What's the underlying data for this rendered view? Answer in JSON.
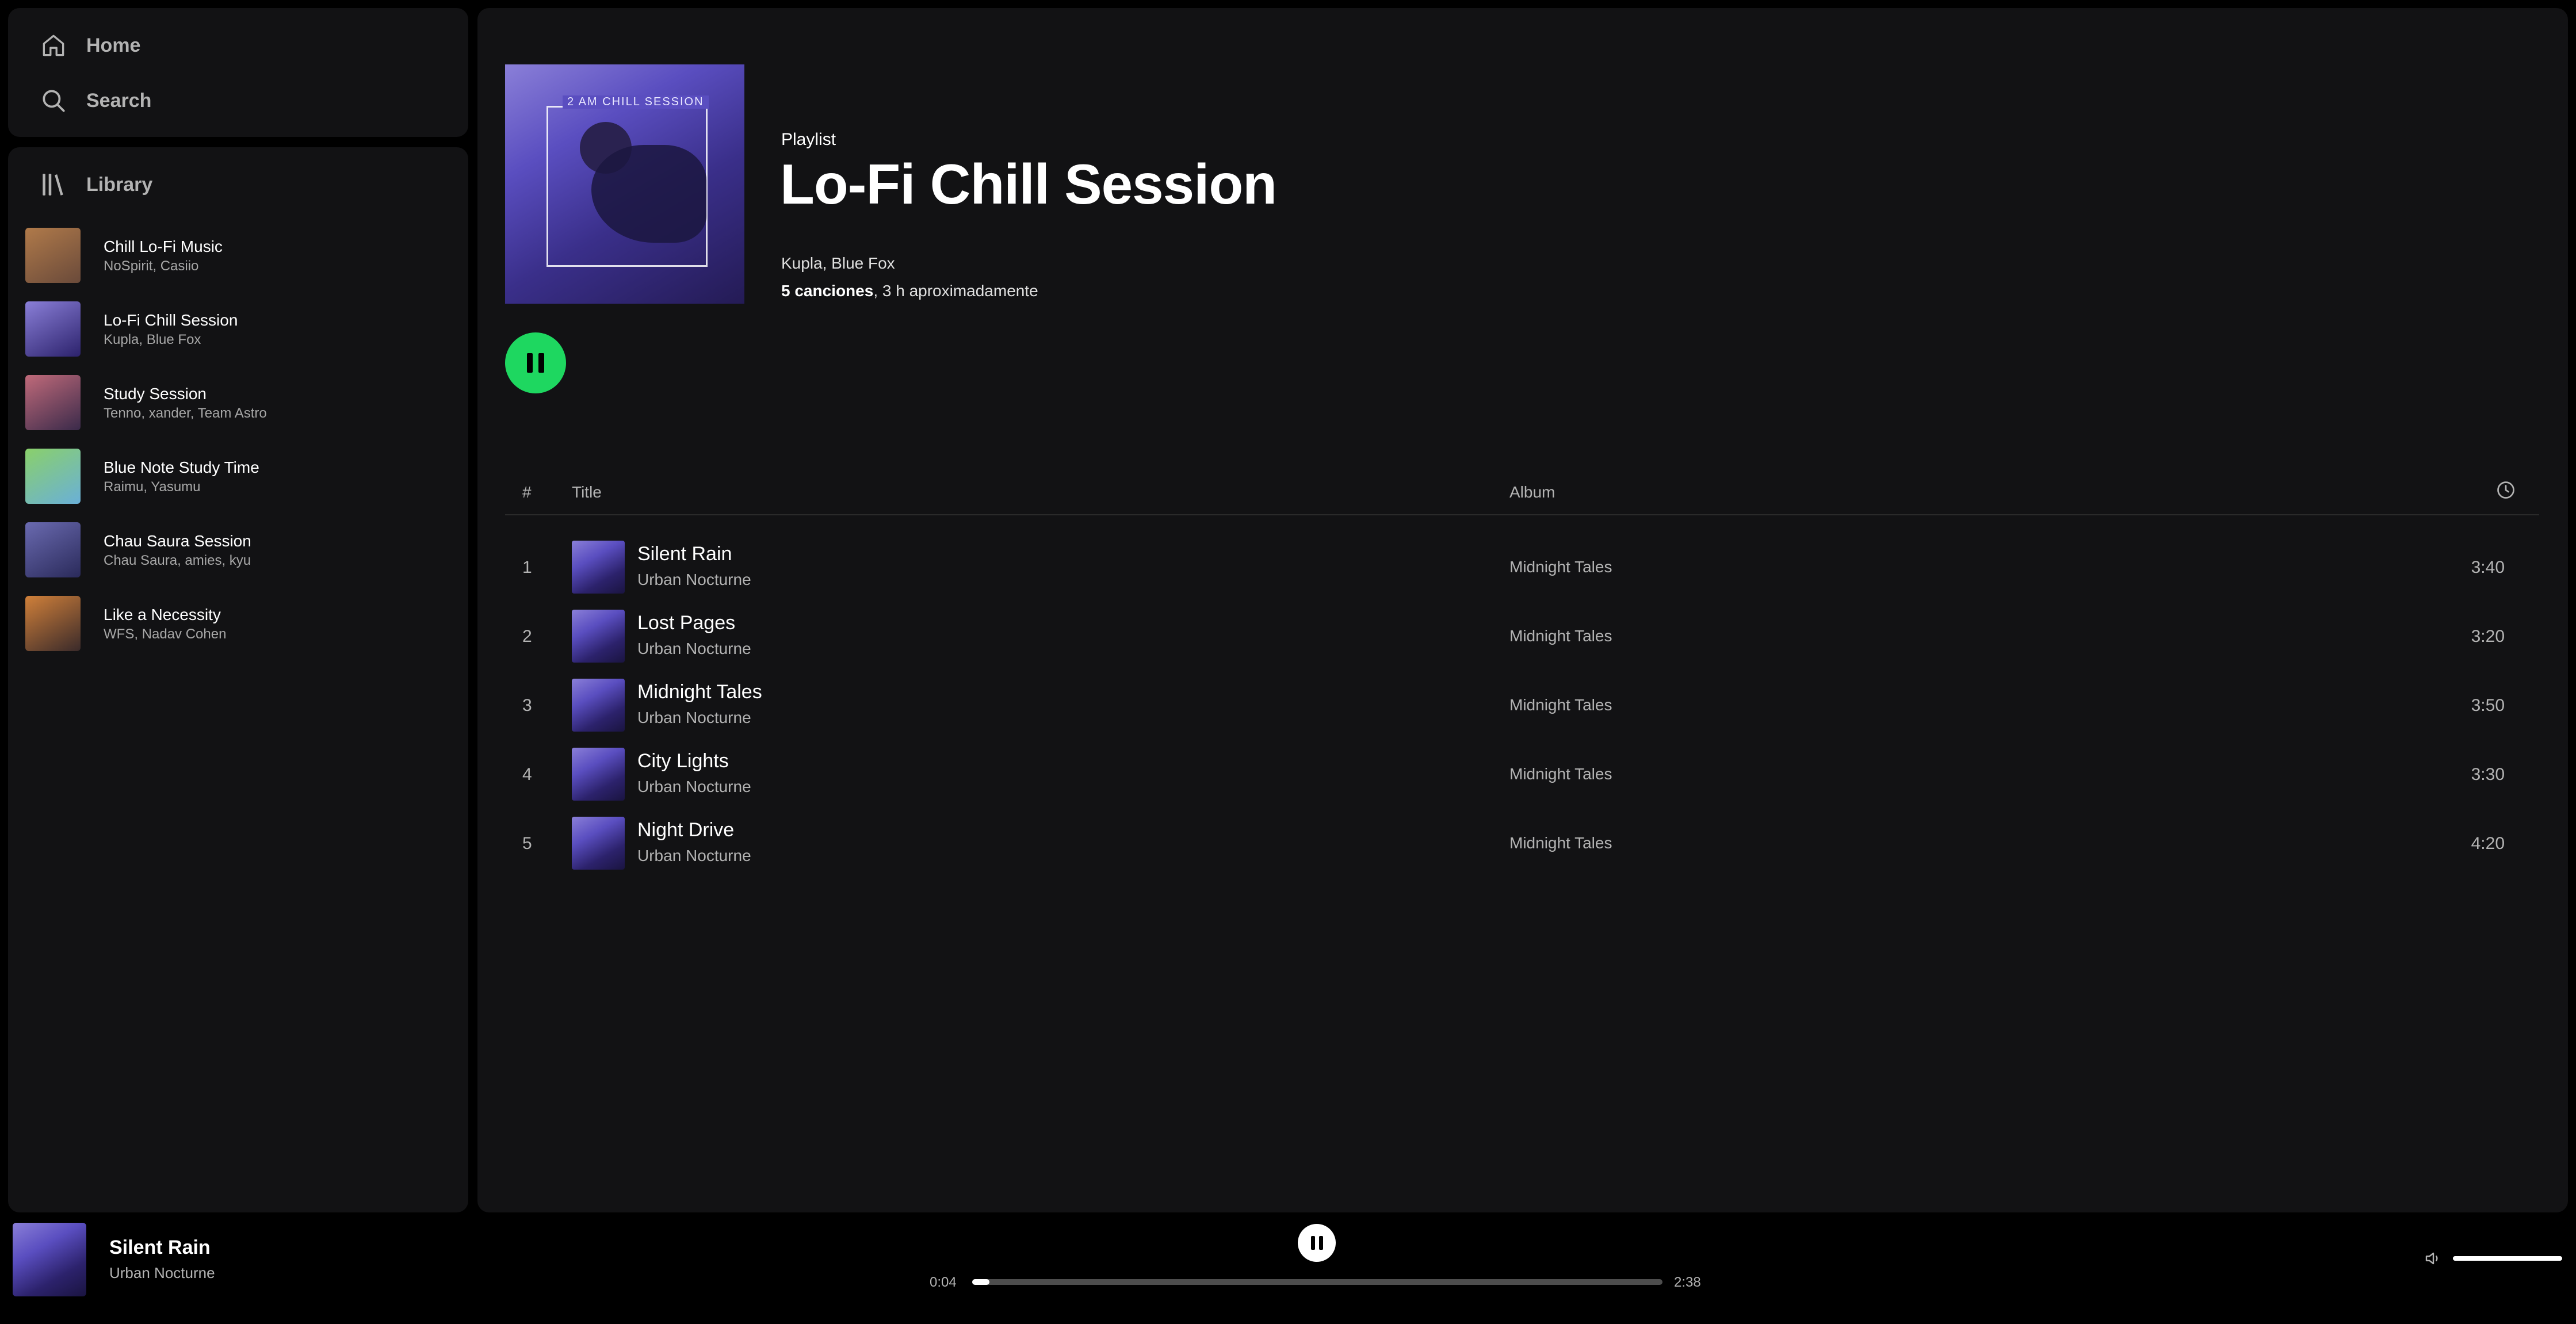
{
  "nav": {
    "home_label": "Home",
    "search_label": "Search"
  },
  "library": {
    "title": "Library",
    "items": [
      {
        "name": "Chill Lo-Fi Music",
        "subtitle": "NoSpirit, Casiio",
        "colors": [
          "#6a4a3a",
          "#b07a4a"
        ]
      },
      {
        "name": "Lo-Fi Chill Session",
        "subtitle": "Kupla, Blue Fox",
        "colors": [
          "#2c226c",
          "#8a7fd8"
        ]
      },
      {
        "name": "Study Session",
        "subtitle": "Tenno, xander, Team Astro",
        "colors": [
          "#3a2a4a",
          "#c06a7a"
        ]
      },
      {
        "name": "Blue Note Study Time",
        "subtitle": "Raimu, Yasumu",
        "colors": [
          "#6ab0d8",
          "#8ad06a"
        ]
      },
      {
        "name": "Chau Saura Session",
        "subtitle": "Chau Saura, amies, kyu",
        "colors": [
          "#2a2a5a",
          "#6a6ab0"
        ]
      },
      {
        "name": "Like a Necessity",
        "subtitle": "WFS, Nadav Cohen",
        "colors": [
          "#3a2a2a",
          "#d0803a"
        ]
      }
    ]
  },
  "playlist": {
    "type": "Playlist",
    "title": "Lo-Fi Chill Session",
    "cover_text": "2 AM CHILL SESSION",
    "artists": "Kupla, Blue Fox",
    "song_count": "5 canciones",
    "duration": ", 3 h aproximadamente"
  },
  "table": {
    "col_num": "#",
    "col_title": "Title",
    "col_album": "Album",
    "col_duration_icon": "clock-icon"
  },
  "tracks": [
    {
      "num": "1",
      "title": "Silent Rain",
      "artist": "Urban Nocturne",
      "album": "Midnight Tales",
      "duration": "3:40"
    },
    {
      "num": "2",
      "title": "Lost Pages",
      "artist": "Urban Nocturne",
      "album": "Midnight Tales",
      "duration": "3:20"
    },
    {
      "num": "3",
      "title": "Midnight Tales",
      "artist": "Urban Nocturne",
      "album": "Midnight Tales",
      "duration": "3:50"
    },
    {
      "num": "4",
      "title": "City Lights",
      "artist": "Urban Nocturne",
      "album": "Midnight Tales",
      "duration": "3:30"
    },
    {
      "num": "5",
      "title": "Night Drive",
      "artist": "Urban Nocturne",
      "album": "Midnight Tales",
      "duration": "4:20"
    }
  ],
  "player": {
    "now_playing_title": "Silent Rain",
    "now_playing_artist": "Urban Nocturne",
    "elapsed": "0:04",
    "total": "2:38",
    "progress_fraction": 0.025,
    "volume_fraction": 1.0
  },
  "colors": {
    "accent": "#1ed760",
    "panel": "#121214",
    "background": "#000000"
  }
}
